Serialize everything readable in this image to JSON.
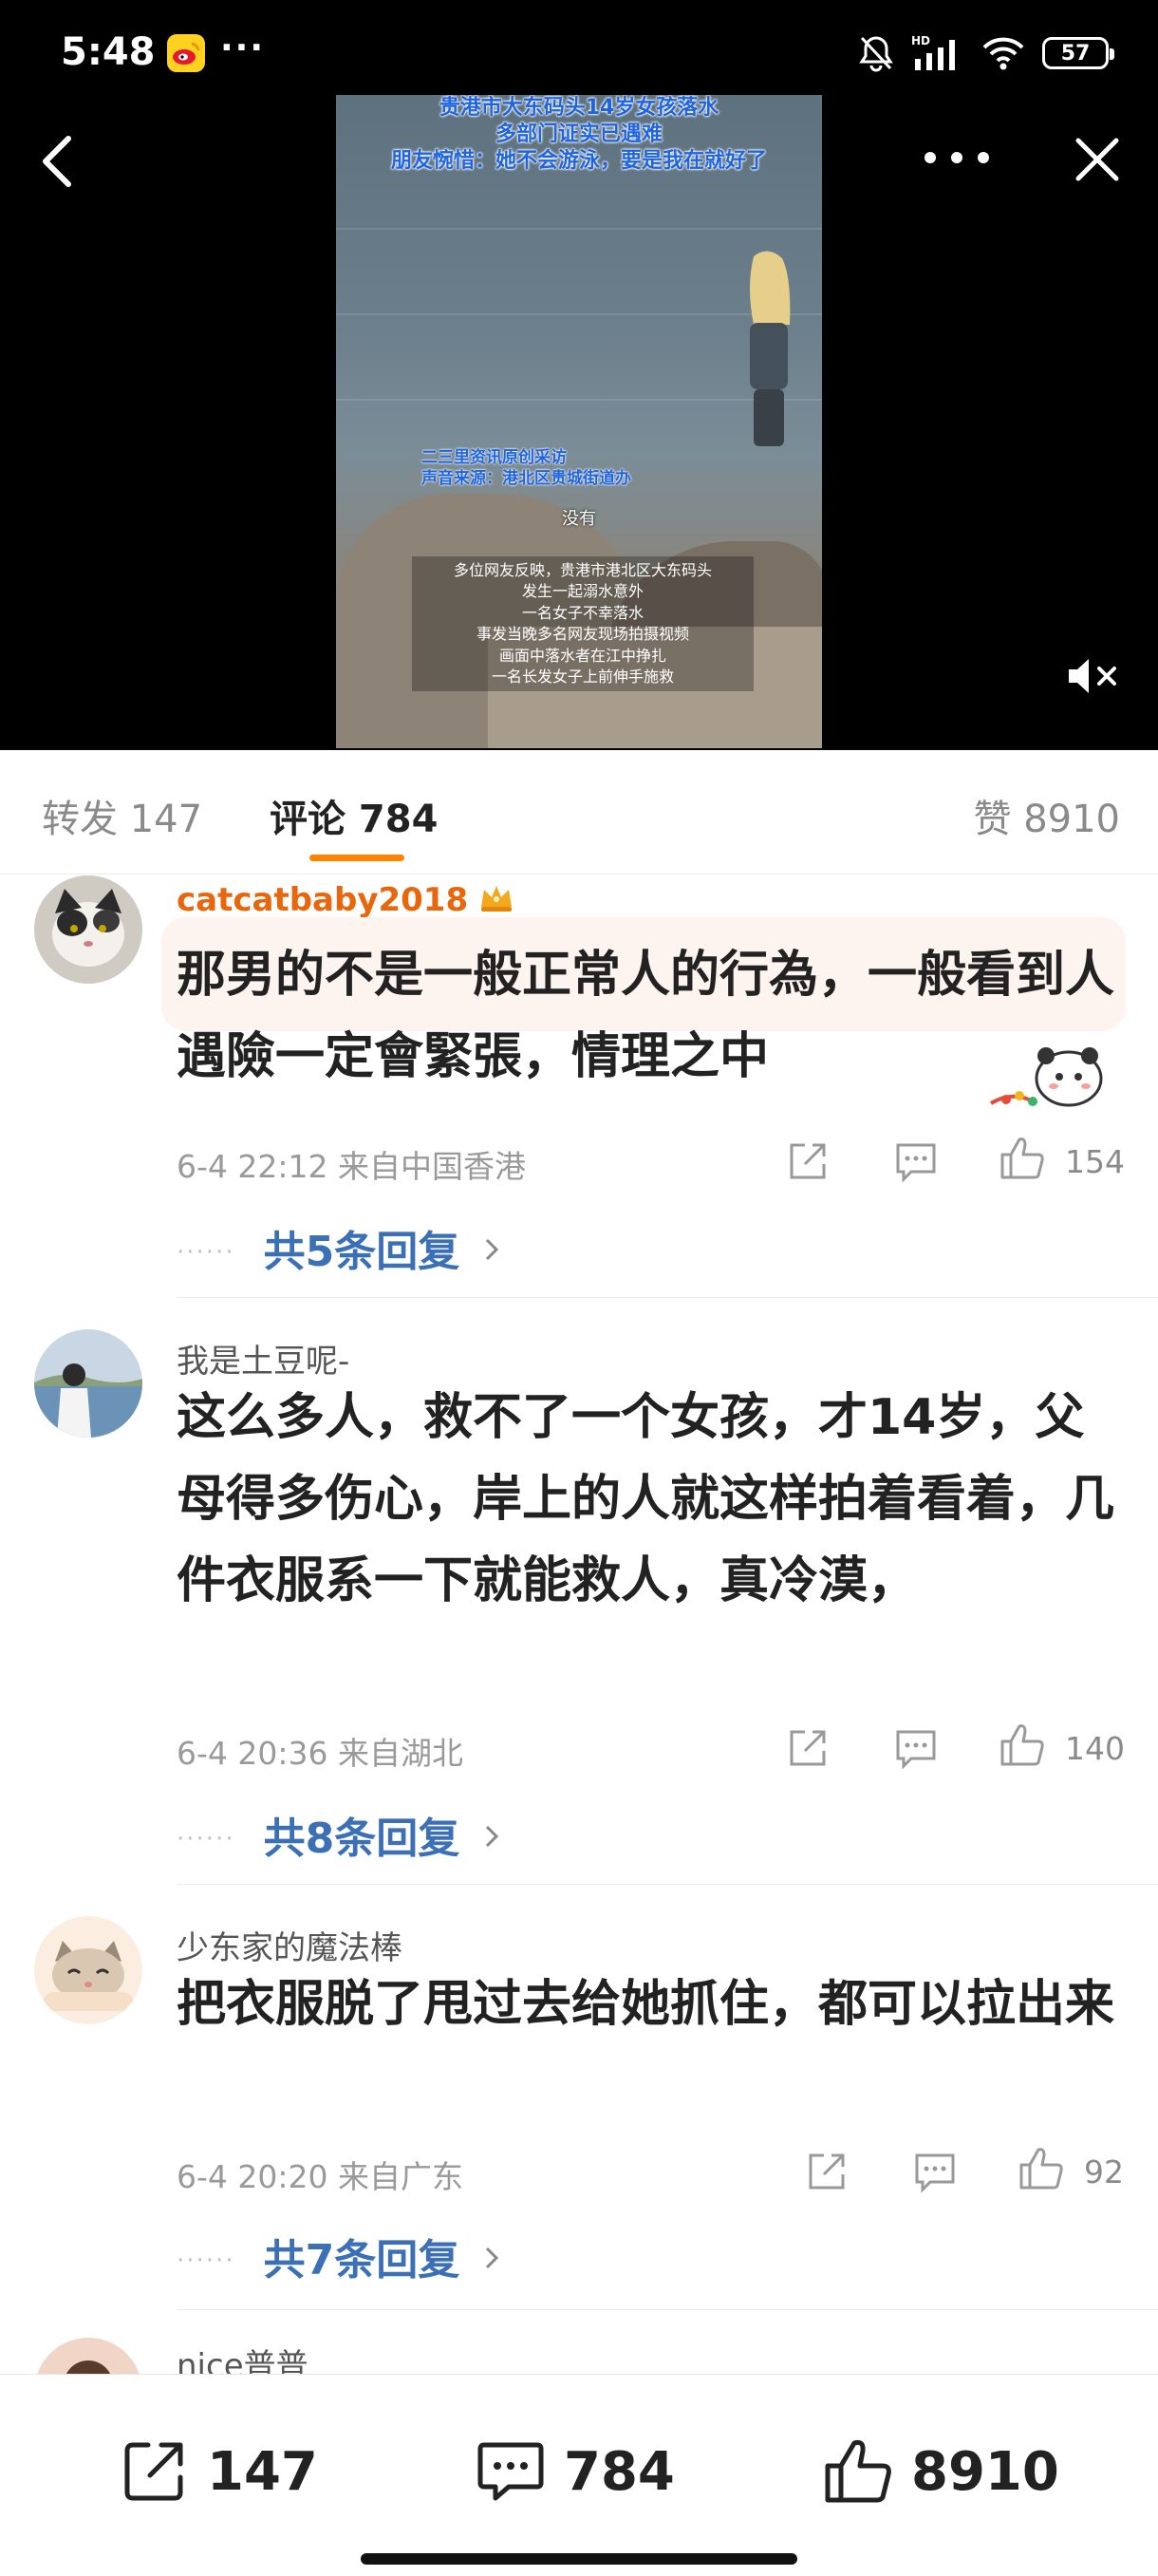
{
  "status_bar": {
    "time": "5:48",
    "overflow": "···",
    "battery": "57",
    "network": "HD"
  },
  "video": {
    "title_lines": [
      "贵港市大东码头14岁女孩落水",
      "多部门证实已遇难",
      "朋友惋惜：她不会游泳，要是我在就好了"
    ],
    "source_lines": [
      "二三里资讯原创采访",
      "声音来源：港北区贵城街道办"
    ],
    "mid_caption": "没有",
    "subtitle_lines": [
      "多位网友反映，贵港市港北区大东码头",
      "发生一起溺水意外",
      "一名女子不幸落水",
      "事发当晚多名网友现场拍摄视频",
      "画面中落水者在江中挣扎",
      "一名长发女子上前伸手施救"
    ]
  },
  "tabs": {
    "repost": "转发 147",
    "comment": "评论 784",
    "like": "赞 8910"
  },
  "comments": [
    {
      "user": "catcatbaby2018",
      "text": "那男的不是一般正常人的行為，一般看到人遇險一定會緊張，情理之中",
      "time_loc": "6-4 22:12 来自中国香港",
      "likes": "154",
      "replies": "共5条回复"
    },
    {
      "user": "我是土豆呢-",
      "text": "这么多人，救不了一个女孩，才14岁，父母得多伤心，岸上的人就这样拍着看着，几件衣服系一下就能救人，真冷漠，",
      "time_loc": "6-4 20:36 来自湖北",
      "likes": "140",
      "replies": "共8条回复"
    },
    {
      "user": "少东家的魔法棒",
      "text": "把衣服脱了甩过去给她抓住，都可以拉出来",
      "time_loc": "6-4 20:20 来自广东",
      "likes": "92",
      "replies": "共7条回复"
    },
    {
      "user": "nice普普"
    }
  ],
  "bottom_bar": {
    "repost": "147",
    "comment": "784",
    "like": "8910"
  },
  "colors": {
    "accent": "#ff8200",
    "vip_name": "#e8660c",
    "reply_link": "#3b6fb6"
  }
}
